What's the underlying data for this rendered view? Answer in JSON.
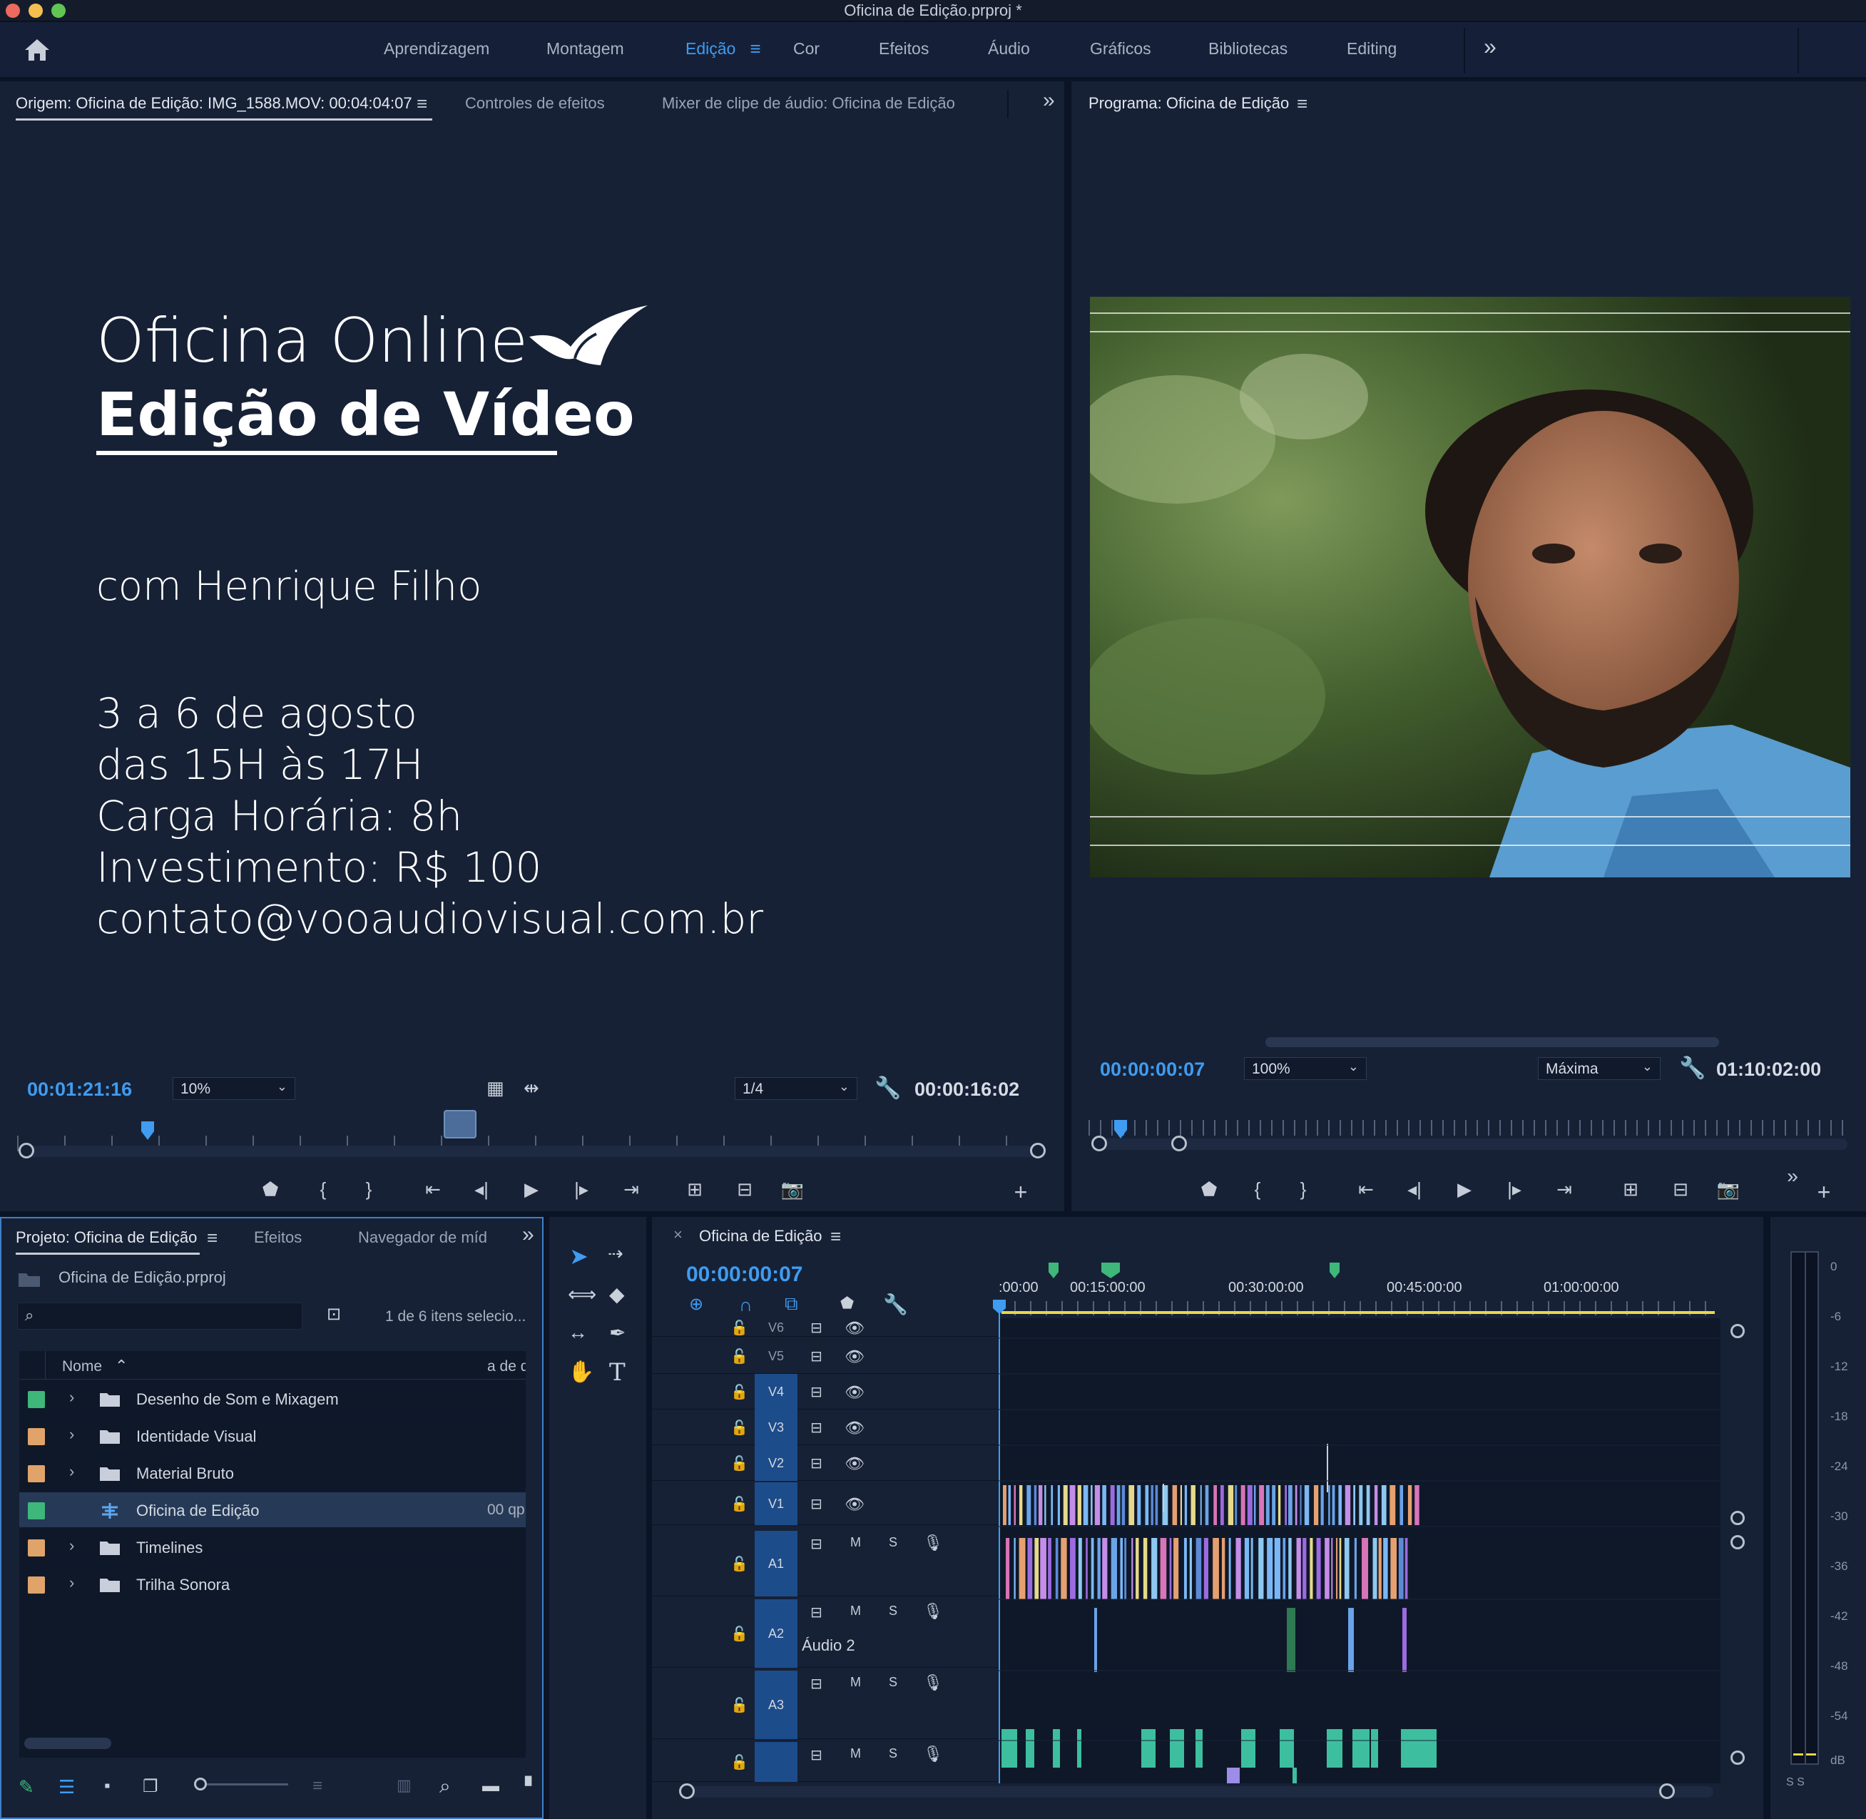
{
  "window": {
    "title": "Oficina de Edição.prproj *"
  },
  "workspaces": {
    "items": [
      "Aprendizagem",
      "Montagem",
      "Edição",
      "Cor",
      "Efeitos",
      "Áudio",
      "Gráficos",
      "Bibliotecas",
      "Editing"
    ],
    "active": "Edição",
    "more": "»"
  },
  "source_panel": {
    "tabs": [
      "Origem: Oficina de Edição: IMG_1588.MOV: 00:04:04:07",
      "Controles de efeitos",
      "Mixer de clipe de áudio: Oficina de Edição"
    ],
    "overflow": "»",
    "content": {
      "line1": "Oficina Online",
      "line2": "Edição de Vídeo",
      "line3": "com Henrique Filho",
      "details": [
        "3 a 6 de agosto",
        "das 15H às 17H",
        "Carga Horária: 8h",
        "Investimento: R$ 100",
        "contato@vooaudiovisual.com.br"
      ]
    },
    "timecode_current": "00:01:21:16",
    "zoom": "10%",
    "resolution": "1/4",
    "timecode_duration": "00:00:16:02"
  },
  "program_panel": {
    "tab": "Programa: Oficina de Edição",
    "timecode_current": "00:00:00:07",
    "zoom": "100%",
    "quality": "Máxima",
    "timecode_duration": "01:10:02:00"
  },
  "project_panel": {
    "tabs": [
      "Projeto: Oficina de Edição",
      "Efeitos",
      "Navegador de míd"
    ],
    "overflow": "»",
    "file": "Oficina de Edição.prproj",
    "search_placeholder": "",
    "selection_status": "1 de 6 itens selecio...",
    "col_name": "Nome",
    "col_rate": "a de q",
    "items": [
      {
        "name": "Desenho de Som e Mixagem",
        "color": "#3fb67a",
        "kind": "folder",
        "extra": ""
      },
      {
        "name": "Identidade Visual",
        "color": "#e0a36a",
        "kind": "folder",
        "extra": ""
      },
      {
        "name": "Material Bruto",
        "color": "#e0a36a",
        "kind": "folder",
        "extra": ""
      },
      {
        "name": "Oficina de Edição",
        "color": "#3fb67a",
        "kind": "sequence",
        "extra": "00 qp"
      },
      {
        "name": "Timelines",
        "color": "#e0a36a",
        "kind": "folder",
        "extra": ""
      },
      {
        "name": "Trilha Sonora",
        "color": "#e0a36a",
        "kind": "folder",
        "extra": ""
      }
    ]
  },
  "timeline": {
    "tab": "Oficina de Edição",
    "close": "×",
    "timecode": "00:00:00:07",
    "ruler": [
      ":00:00",
      "00:15:00:00",
      "00:30:00:00",
      "00:45:00:00",
      "01:00:00:00"
    ],
    "video_tracks": [
      "V6",
      "V5",
      "V4",
      "V3",
      "V2",
      "V1"
    ],
    "audio_tracks": [
      "A1",
      "A2",
      "A3"
    ],
    "audio_track_name": "Áudio 2",
    "mute": "M",
    "solo": "S"
  },
  "meter": {
    "scale": [
      "0",
      "-6",
      "-12",
      "-18",
      "-24",
      "-30",
      "-36",
      "-42",
      "-48",
      "-54",
      "dB"
    ],
    "solo_buttons": "S S"
  },
  "colors": {
    "accent": "#3f9cf0",
    "panel_bg": "#162136",
    "track_label": "#1d4c8a",
    "audio_clip": "#3dbf9f",
    "playhead": "#3f9cf0",
    "work_area": "#e6d94a"
  }
}
